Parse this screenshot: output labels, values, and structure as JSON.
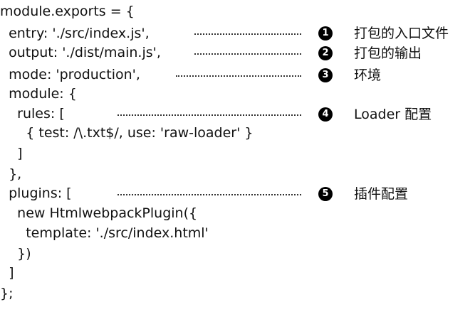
{
  "code_lines": [
    "module.exports = {",
    "  entry: './src/index.js',",
    "  output: './dist/main.js',",
    "  mode: 'production',",
    "  module: {",
    "    rules: [",
    "      { test: /\\.txt$/, use: 'raw-loader' }",
    "    ]",
    "  },",
    "  plugins: [",
    "    new HtmlwebpackPlugin({",
    "      template: './src/index.html'",
    "    })",
    "  ]",
    "};"
  ],
  "annotations": [
    {
      "number": "1",
      "label": "打包的入口文件"
    },
    {
      "number": "2",
      "label": "打包的输出"
    },
    {
      "number": "3",
      "label": "环境"
    },
    {
      "number": "4",
      "label": "Loader 配置"
    },
    {
      "number": "5",
      "label": "插件配置"
    }
  ]
}
